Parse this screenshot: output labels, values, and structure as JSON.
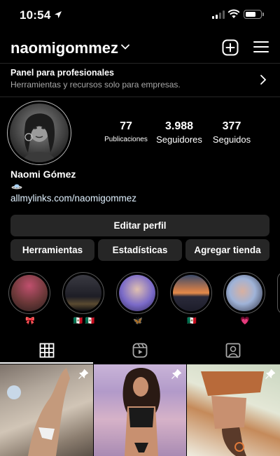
{
  "status_bar": {
    "time": "10:54"
  },
  "header": {
    "username": "naomigommez"
  },
  "panel": {
    "title": "Panel para profesionales",
    "subtitle": "Herramientas y recursos solo para empresas."
  },
  "profile": {
    "stats": [
      {
        "value": "77",
        "label": "Publicaciones"
      },
      {
        "value": "3.988",
        "label": "Seguidores"
      },
      {
        "value": "377",
        "label": "Seguidos"
      }
    ],
    "name": "Naomi Gómez",
    "bio_icon": "ufo-icon",
    "link": "allmylinks.com/naomigommez"
  },
  "buttons": {
    "edit_profile": "Editar perfil",
    "tools": "Herramientas",
    "stats": "Estadísticas",
    "add_shop": "Agregar tienda"
  },
  "highlights": [
    {
      "caption": "🎀",
      "colors": [
        "#c0506e",
        "#3b2a2a"
      ]
    },
    {
      "caption": "🇲🇽 🇲🇽",
      "colors": [
        "#2c2c35",
        "#0c0c12"
      ]
    },
    {
      "caption": "🦋",
      "colors": [
        "#7a6ac8",
        "#2d2550"
      ]
    },
    {
      "caption": "🇲🇽",
      "colors": [
        "#e38a4a",
        "#1d1d2a"
      ]
    },
    {
      "caption": "💗",
      "colors": [
        "#9fb3d8",
        "#2a2a3a"
      ]
    }
  ],
  "tabs": [
    {
      "name": "posts-grid",
      "icon": "grid-icon",
      "active": true
    },
    {
      "name": "reels",
      "icon": "reels-icon",
      "active": false
    },
    {
      "name": "tagged",
      "icon": "tagged-icon",
      "active": false
    }
  ],
  "posts": [
    {
      "pinned": true
    },
    {
      "pinned": true
    },
    {
      "pinned": true
    }
  ]
}
